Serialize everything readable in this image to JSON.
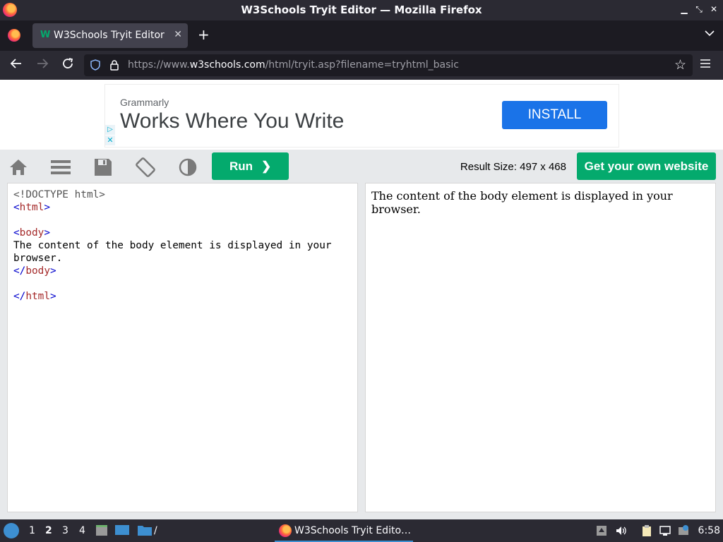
{
  "window": {
    "title": "W3Schools Tryit Editor — Mozilla Firefox"
  },
  "tabs": [
    {
      "label": "W3Schools Tryit Editor",
      "favicon": "w3schools-favicon",
      "active": true
    }
  ],
  "navbar": {
    "url_prefix": "https://www.",
    "url_domain": "w3schools.com",
    "url_path": "/html/tryit.asp?filename=tryhtml_basic"
  },
  "ad": {
    "brand": "Grammarly",
    "headline": "Works Where You Write",
    "cta": "INSTALL"
  },
  "toolbar": {
    "run_label": "Run",
    "run_arrow": "❯",
    "result_size": "Result Size: 497 x 468",
    "get_website_label": "Get your own website"
  },
  "editor": {
    "lines": [
      {
        "parts": [
          {
            "t": "doc",
            "v": "<!DOCTYPE html>"
          }
        ]
      },
      {
        "parts": [
          {
            "t": "br",
            "v": "<"
          },
          {
            "t": "tag",
            "v": "html"
          },
          {
            "t": "br",
            "v": ">"
          }
        ]
      },
      {
        "parts": []
      },
      {
        "parts": [
          {
            "t": "br",
            "v": "<"
          },
          {
            "t": "tag",
            "v": "body"
          },
          {
            "t": "br",
            "v": ">"
          }
        ]
      },
      {
        "parts": [
          {
            "t": "txt",
            "v": "The content of the body element is displayed in your"
          }
        ]
      },
      {
        "parts": [
          {
            "t": "txt",
            "v": "browser."
          }
        ]
      },
      {
        "parts": [
          {
            "t": "br",
            "v": "</"
          },
          {
            "t": "tag",
            "v": "body"
          },
          {
            "t": "br",
            "v": ">"
          }
        ]
      },
      {
        "parts": []
      },
      {
        "parts": [
          {
            "t": "br",
            "v": "</"
          },
          {
            "t": "tag",
            "v": "html"
          },
          {
            "t": "br",
            "v": ">"
          }
        ]
      }
    ]
  },
  "result": {
    "text": "The content of the body element is displayed in your browser."
  },
  "taskbar": {
    "workspaces": [
      "1",
      "2",
      "3",
      "4"
    ],
    "active_workspace": "2",
    "task_label": "W3Schools Tryit Edito…",
    "clock": "6:58"
  }
}
